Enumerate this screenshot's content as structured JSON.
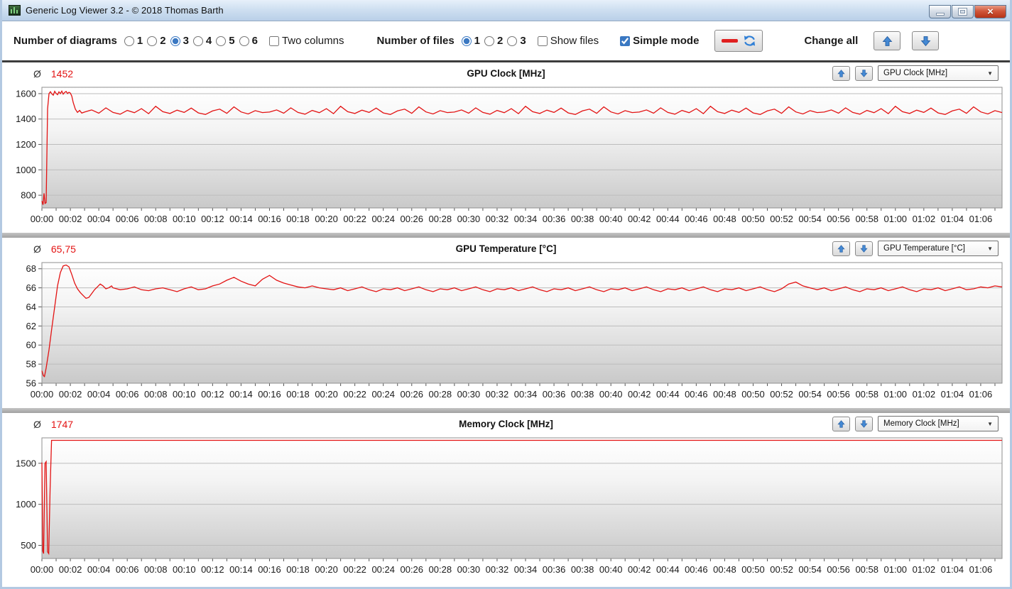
{
  "window": {
    "title": "Generic Log Viewer 3.2 - © 2018 Thomas Barth"
  },
  "toolbar": {
    "diagrams_label": "Number of diagrams",
    "diagram_options": [
      {
        "label": "1"
      },
      {
        "label": "2"
      },
      {
        "label": "3",
        "checked": "checked"
      },
      {
        "label": "4"
      },
      {
        "label": "5"
      },
      {
        "label": "6"
      }
    ],
    "two_columns_label": "Two columns",
    "files_label": "Number of files",
    "file_options": [
      {
        "label": "1",
        "checked": "checked"
      },
      {
        "label": "2"
      },
      {
        "label": "3"
      }
    ],
    "show_files_label": "Show files",
    "simple_mode_label": "Simple mode",
    "simple_mode_checked": "checked",
    "change_all_label": "Change all"
  },
  "colors": {
    "line_red": "#e31313",
    "arrow_blue": "#4489d4",
    "grid": "#bdbdbd",
    "plot_border": "#8f8f8f"
  },
  "chart_data": [
    {
      "type": "line",
      "title": "GPU Clock [MHz]",
      "average_label": "Ø",
      "average": "1452",
      "dropdown": "GPU Clock [MHz]",
      "xlabel": "",
      "ylabel": "",
      "grid": true,
      "legend": "none",
      "ylim": [
        700,
        1650
      ],
      "yticks": [
        800,
        1000,
        1200,
        1400,
        1600
      ],
      "xlim_minutes": [
        0,
        67.5
      ],
      "x_tick_labels": [
        "00:00",
        "00:02",
        "00:04",
        "00:06",
        "00:08",
        "00:10",
        "00:12",
        "00:14",
        "00:16",
        "00:18",
        "00:20",
        "00:22",
        "00:24",
        "00:26",
        "00:28",
        "00:30",
        "00:32",
        "00:34",
        "00:36",
        "00:38",
        "00:40",
        "00:42",
        "00:44",
        "00:46",
        "00:48",
        "00:50",
        "00:52",
        "00:54",
        "00:56",
        "00:58",
        "01:00",
        "01:02",
        "01:04",
        "01:06"
      ],
      "series": [
        {
          "name": "GPU Clock",
          "color": "#e31313",
          "points": [
            [
              0,
              755
            ],
            [
              0.08,
              725
            ],
            [
              0.15,
              815
            ],
            [
              0.22,
              735
            ],
            [
              0.3,
              742
            ],
            [
              0.4,
              1480
            ],
            [
              0.5,
              1600
            ],
            [
              0.6,
              1615
            ],
            [
              0.7,
              1598
            ],
            [
              0.8,
              1588
            ],
            [
              0.9,
              1618
            ],
            [
              1.0,
              1602
            ],
            [
              1.1,
              1592
            ],
            [
              1.2,
              1614
            ],
            [
              1.3,
              1600
            ],
            [
              1.4,
              1620
            ],
            [
              1.5,
              1596
            ],
            [
              1.6,
              1610
            ],
            [
              1.7,
              1617
            ],
            [
              1.8,
              1601
            ],
            [
              1.9,
              1611
            ],
            [
              2.0,
              1604
            ],
            [
              2.1,
              1580
            ],
            [
              2.2,
              1530
            ],
            [
              2.35,
              1478
            ],
            [
              2.5,
              1452
            ],
            [
              2.65,
              1468
            ],
            [
              2.8,
              1447
            ]
          ],
          "steady": {
            "t0": 3,
            "dt": 0.5,
            "values": [
              1455,
              1472,
              1446,
              1488,
              1452,
              1438,
              1468,
              1450,
              1482,
              1442,
              1500,
              1458,
              1444,
              1470,
              1452,
              1486,
              1448,
              1436,
              1464,
              1478,
              1445,
              1496,
              1456,
              1440,
              1466,
              1451,
              1455,
              1472,
              1446,
              1488,
              1452,
              1438,
              1468,
              1450,
              1482,
              1442,
              1500,
              1458,
              1444,
              1470,
              1452,
              1486,
              1448,
              1436,
              1464,
              1478,
              1445,
              1496,
              1456,
              1440,
              1466,
              1451,
              1455,
              1472,
              1446,
              1488,
              1452,
              1438,
              1468,
              1450,
              1482,
              1442,
              1500,
              1458,
              1444,
              1470,
              1452,
              1486,
              1448,
              1436,
              1464,
              1478,
              1445,
              1496,
              1456,
              1440,
              1466,
              1451,
              1455,
              1472,
              1446,
              1488,
              1452,
              1438,
              1468,
              1450,
              1482,
              1442,
              1500,
              1458,
              1444,
              1470,
              1452,
              1486,
              1448,
              1436,
              1464,
              1478,
              1445,
              1496,
              1456,
              1440,
              1466,
              1451,
              1455,
              1472,
              1446,
              1488,
              1452,
              1438,
              1468,
              1450,
              1482,
              1442,
              1500,
              1458,
              1444,
              1470,
              1452,
              1486,
              1448,
              1436,
              1464,
              1478,
              1445,
              1496,
              1456,
              1440,
              1466,
              1451
            ]
          }
        }
      ]
    },
    {
      "type": "line",
      "title": "GPU Temperature [°C]",
      "average_label": "Ø",
      "average": "65,75",
      "dropdown": "GPU Temperature [°C]",
      "xlabel": "",
      "ylabel": "",
      "grid": true,
      "legend": "none",
      "ylim": [
        56,
        68.65
      ],
      "yticks": [
        56,
        58,
        60,
        62,
        64,
        66,
        68
      ],
      "xlim_minutes": [
        0,
        67.5
      ],
      "x_tick_labels": [
        "00:00",
        "00:02",
        "00:04",
        "00:06",
        "00:08",
        "00:10",
        "00:12",
        "00:14",
        "00:16",
        "00:18",
        "00:20",
        "00:22",
        "00:24",
        "00:26",
        "00:28",
        "00:30",
        "00:32",
        "00:34",
        "00:36",
        "00:38",
        "00:40",
        "00:42",
        "00:44",
        "00:46",
        "00:48",
        "00:50",
        "00:52",
        "00:54",
        "00:56",
        "00:58",
        "01:00",
        "01:02",
        "01:04",
        "01:06"
      ],
      "series": [
        {
          "name": "GPU Temperature",
          "color": "#e31313",
          "points": [
            [
              0,
              57.3
            ],
            [
              0.1,
              56.8
            ],
            [
              0.18,
              56.7
            ],
            [
              0.3,
              57.6
            ],
            [
              0.5,
              59.5
            ],
            [
              0.7,
              61.8
            ],
            [
              0.9,
              64.0
            ],
            [
              1.1,
              66.2
            ],
            [
              1.3,
              67.6
            ],
            [
              1.5,
              68.3
            ],
            [
              1.7,
              68.4
            ],
            [
              1.9,
              68.2
            ],
            [
              2.1,
              67.4
            ],
            [
              2.3,
              66.5
            ],
            [
              2.5,
              65.9
            ],
            [
              2.7,
              65.5
            ],
            [
              2.9,
              65.2
            ],
            [
              3.1,
              64.9
            ],
            [
              3.3,
              65.0
            ],
            [
              3.5,
              65.4
            ],
            [
              3.7,
              65.8
            ],
            [
              3.9,
              66.1
            ],
            [
              4.1,
              66.4
            ],
            [
              4.3,
              66.2
            ],
            [
              4.5,
              65.9
            ],
            [
              4.7,
              66.0
            ],
            [
              4.9,
              66.2
            ]
          ],
          "steady": {
            "t0": 5,
            "dt": 0.5,
            "values": [
              66.0,
              65.8,
              65.9,
              66.1,
              65.8,
              65.7,
              65.9,
              66.0,
              65.8,
              65.6,
              65.9,
              66.1,
              65.8,
              65.9,
              66.2,
              66.4,
              66.8,
              67.1,
              66.7,
              66.4,
              66.2,
              66.9,
              67.3,
              66.8,
              66.5,
              66.3,
              66.1,
              66.0,
              66.2,
              66.0,
              65.9,
              65.8,
              66.0,
              65.7,
              65.9,
              66.1,
              65.8,
              65.6,
              65.9,
              65.8,
              66.0,
              65.7,
              65.9,
              66.1,
              65.8,
              65.6,
              65.9,
              65.8,
              66.0,
              65.7,
              65.9,
              66.1,
              65.8,
              65.6,
              65.9,
              65.8,
              66.0,
              65.7,
              65.9,
              66.1,
              65.8,
              65.6,
              65.9,
              65.8,
              66.0,
              65.7,
              65.9,
              66.1,
              65.8,
              65.6,
              65.9,
              65.8,
              66.0,
              65.7,
              65.9,
              66.1,
              65.8,
              65.6,
              65.9,
              65.8,
              66.0,
              65.7,
              65.9,
              66.1,
              65.8,
              65.6,
              65.9,
              65.8,
              66.0,
              65.7,
              65.9,
              66.1,
              65.8,
              65.6,
              65.9,
              66.4,
              66.6,
              66.2,
              66.0,
              65.8,
              66.0,
              65.7,
              65.9,
              66.1,
              65.8,
              65.6,
              65.9,
              65.8,
              66.0,
              65.7,
              65.9,
              66.1,
              65.8,
              65.6,
              65.9,
              65.8,
              66.0,
              65.7,
              65.9,
              66.1,
              65.8,
              65.9,
              66.1,
              66.0,
              66.2,
              66.1
            ]
          }
        }
      ]
    },
    {
      "type": "line",
      "title": "Memory Clock [MHz]",
      "average_label": "Ø",
      "average": "1747",
      "dropdown": "Memory Clock [MHz]",
      "xlabel": "",
      "ylabel": "",
      "grid": true,
      "legend": "none",
      "ylim": [
        340,
        1810
      ],
      "yticks": [
        500,
        1000,
        1500
      ],
      "xlim_minutes": [
        0,
        67.5
      ],
      "x_tick_labels": [
        "00:00",
        "00:02",
        "00:04",
        "00:06",
        "00:08",
        "00:10",
        "00:12",
        "00:14",
        "00:16",
        "00:18",
        "00:20",
        "00:22",
        "00:24",
        "00:26",
        "00:28",
        "00:30",
        "00:32",
        "00:34",
        "00:36",
        "00:38",
        "00:40",
        "00:42",
        "00:44",
        "00:46",
        "00:48",
        "00:50",
        "00:52",
        "00:54",
        "00:56",
        "00:58",
        "01:00",
        "01:02",
        "01:04",
        "01:06"
      ],
      "series": [
        {
          "name": "Memory Clock",
          "color": "#e31313",
          "points": [
            [
              0,
              1510
            ],
            [
              0.06,
              430
            ],
            [
              0.12,
              400
            ],
            [
              0.22,
              1500
            ],
            [
              0.3,
              1520
            ],
            [
              0.4,
              420
            ],
            [
              0.48,
              400
            ],
            [
              0.58,
              1200
            ],
            [
              0.68,
              1780
            ],
            [
              67.5,
              1780
            ]
          ]
        }
      ]
    }
  ]
}
